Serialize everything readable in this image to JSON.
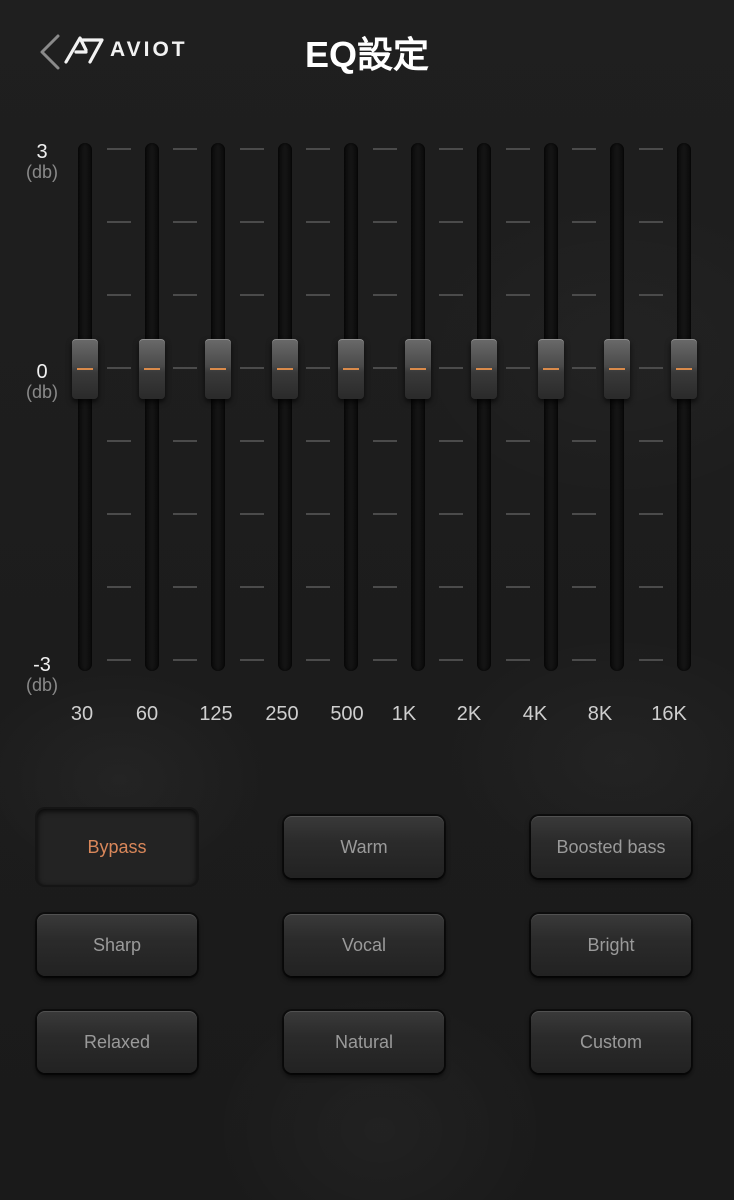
{
  "header": {
    "back_icon": "chevron-left-icon",
    "logo_text": "AVIOT",
    "logo_icon": "aviot-logo-icon",
    "title": "EQ設定"
  },
  "scale": {
    "top": {
      "value": "3",
      "unit": "(db)"
    },
    "mid": {
      "value": "0",
      "unit": "(db)"
    },
    "bottom": {
      "value": "-3",
      "unit": "(db)"
    }
  },
  "eq_bands": [
    {
      "freq": "30",
      "gain_db": 0
    },
    {
      "freq": "60",
      "gain_db": 0
    },
    {
      "freq": "125",
      "gain_db": 0
    },
    {
      "freq": "250",
      "gain_db": 0
    },
    {
      "freq": "500",
      "gain_db": 0
    },
    {
      "freq": "1K",
      "gain_db": 0
    },
    {
      "freq": "2K",
      "gain_db": 0
    },
    {
      "freq": "4K",
      "gain_db": 0
    },
    {
      "freq": "8K",
      "gain_db": 0
    },
    {
      "freq": "16K",
      "gain_db": 0
    }
  ],
  "presets": [
    {
      "label": "Bypass",
      "active": true
    },
    {
      "label": "Warm",
      "active": false
    },
    {
      "label": "Boosted bass",
      "active": false
    },
    {
      "label": "Sharp",
      "active": false
    },
    {
      "label": "Vocal",
      "active": false
    },
    {
      "label": "Bright",
      "active": false
    },
    {
      "label": "Relaxed",
      "active": false
    },
    {
      "label": "Natural",
      "active": false
    },
    {
      "label": "Custom",
      "active": false
    }
  ],
  "colors": {
    "accent": "#d9875a",
    "background": "#1c1c1c"
  }
}
